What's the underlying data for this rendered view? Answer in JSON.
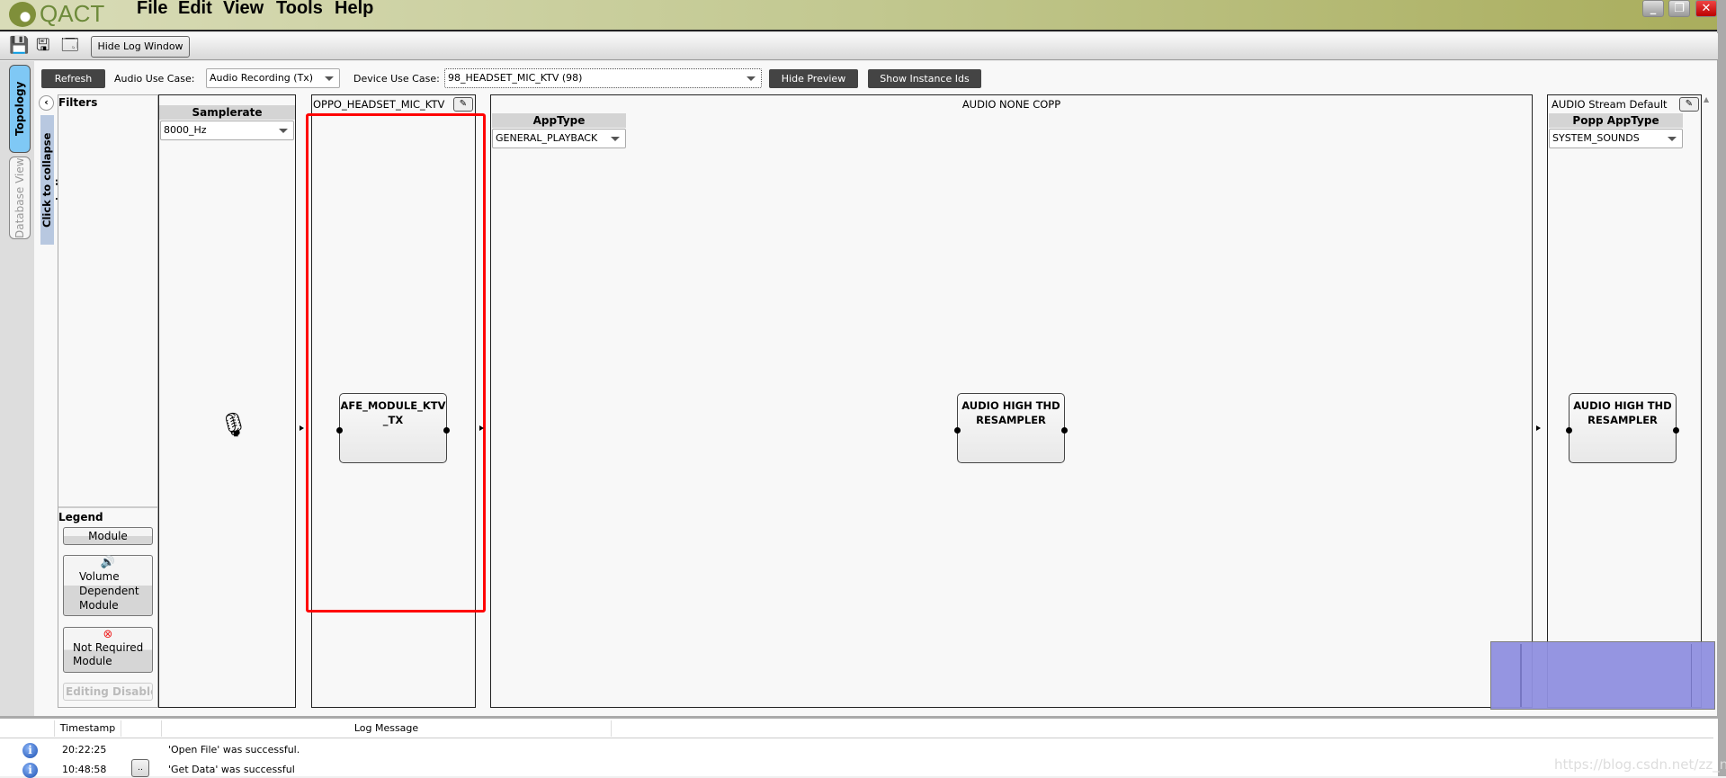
{
  "app": {
    "title": "QACT",
    "menu": [
      "File",
      "Edit",
      "View",
      "Tools",
      "Help"
    ]
  },
  "toolbar": {
    "hide_log": "Hide Log Window"
  },
  "side_tabs": {
    "topology": "Topology View",
    "database": "Database View",
    "collapse": "Click to collapse indices"
  },
  "controls": {
    "refresh": "Refresh",
    "audio_use_case_label": "Audio Use Case:",
    "audio_use_case": "Audio Recording (Tx)",
    "device_use_case_label": "Device Use Case:",
    "device_use_case": "98_HEADSET_MIC_KTV (98)",
    "hide_preview": "Hide Preview",
    "show_instance_ids": "Show Instance Ids"
  },
  "filters": {
    "title": "Filters",
    "legend_title": "Legend",
    "legend": {
      "module": "Module",
      "volume": "Volume Dependent Module",
      "not_required": "Not Required Module",
      "editing_disabled": "Editing Disabled"
    }
  },
  "columns": {
    "samplerate": {
      "header": "Samplerate",
      "value": "8000_Hz"
    },
    "oppo": {
      "title": "OPPO_HEADSET_MIC_KTV",
      "module": "AFE_MODULE_KTV_TX"
    },
    "copp": {
      "title": "AUDIO NONE COPP",
      "header": "AppType",
      "value": "GENERAL_PLAYBACK",
      "module": "AUDIO HIGH THD RESAMPLER"
    },
    "stream": {
      "title": "AUDIO Stream Default",
      "header": "Popp AppType",
      "value": "SYSTEM_SOUNDS",
      "module": "AUDIO HIGH THD RESAMPLER"
    }
  },
  "log": {
    "headers": [
      "Timestamp",
      "",
      "Log Message"
    ],
    "rows": [
      {
        "time": "20:22:25",
        "message": "'Open File' was successful."
      },
      {
        "time": "10:48:58",
        "message": "'Get Data' was successful"
      }
    ],
    "more": ".."
  },
  "watermark": "https://blog.csdn.net/zz_nj",
  "colors": {
    "highlight": "#ff0000",
    "minimap": "#9090e0",
    "title_bar": "#c2c890"
  }
}
